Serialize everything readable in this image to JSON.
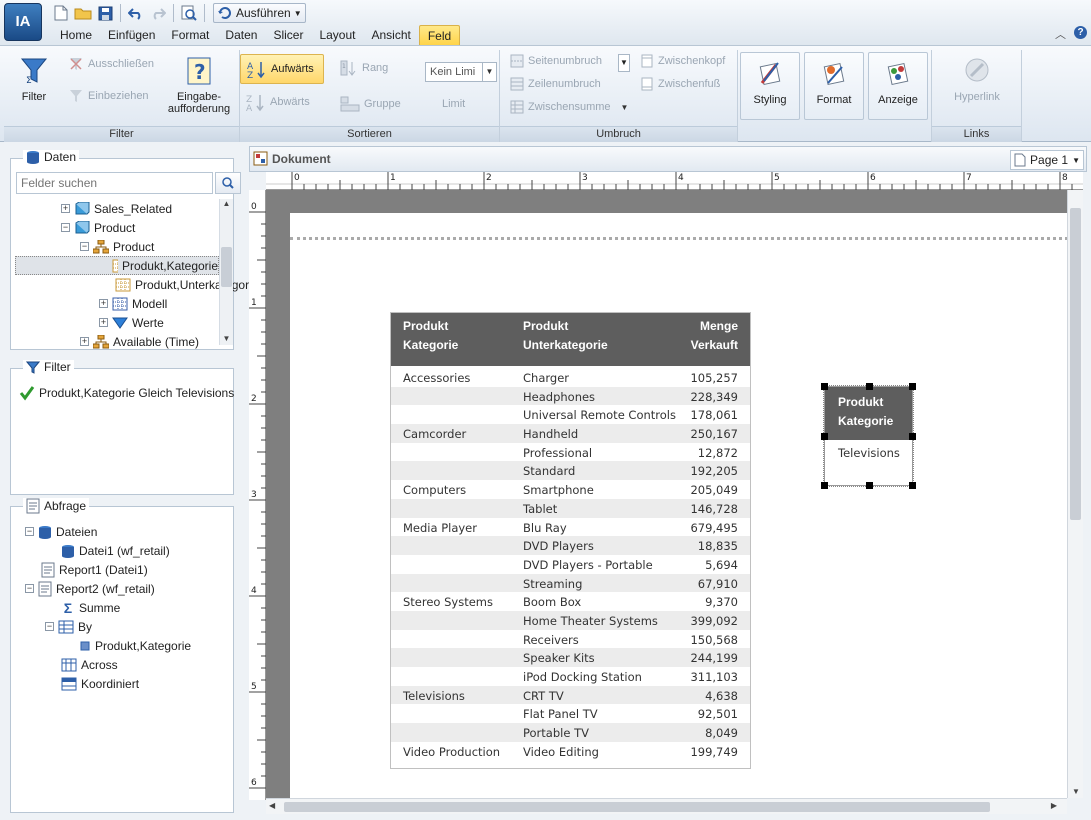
{
  "app": {
    "logo": "IA"
  },
  "quick_access": {
    "run_label": "Ausführen"
  },
  "menu": [
    "Home",
    "Einfügen",
    "Format",
    "Daten",
    "Slicer",
    "Layout",
    "Ansicht",
    "Feld"
  ],
  "menu_active": "Feld",
  "ribbon": {
    "filter_group": {
      "label": "Filter",
      "filter": "Filter",
      "exclude": "Ausschließen",
      "include": "Einbeziehen",
      "prompt_line1": "Eingabe-",
      "prompt_line2": "aufforderung"
    },
    "sort_group": {
      "label": "Sortieren",
      "asc": "Aufwärts",
      "desc": "Abwärts",
      "rank": "Rang",
      "group": "Gruppe",
      "limit_value": "Kein Limi",
      "limit": "Limit"
    },
    "break_group": {
      "label": "Umbruch",
      "page_break": "Seitenumbruch",
      "row_break": "Zeilenumbruch",
      "subtotal": "Zwischensumme",
      "subhead": "Zwischenkopf",
      "subfoot": "Zwischenfuß"
    },
    "styling": "Styling",
    "format": "Format",
    "display": "Anzeige",
    "links_group": {
      "label": "Links",
      "hyperlink": "Hyperlink"
    }
  },
  "data_panel": {
    "title": "Daten",
    "search_placeholder": "Felder suchen",
    "tree": [
      {
        "label": "Sales_Related"
      },
      {
        "label": "Product"
      },
      {
        "label": "Product"
      },
      {
        "label": "Produkt,Kategorie"
      },
      {
        "label": "Produkt,Unterkategorie"
      },
      {
        "label": "Modell"
      },
      {
        "label": "Werte"
      },
      {
        "label": "Available (Time)"
      }
    ]
  },
  "filter_panel": {
    "title": "Filter",
    "condition": "Produkt,Kategorie Gleich Televisions"
  },
  "query_panel": {
    "title": "Abfrage",
    "items": [
      {
        "label": "Dateien"
      },
      {
        "label": "Datei1 (wf_retail)"
      },
      {
        "label": "Report1 (Datei1)"
      },
      {
        "label": "Report2 (wf_retail)"
      },
      {
        "label": "Summe"
      },
      {
        "label": "By"
      },
      {
        "label": "Produkt,Kategorie"
      },
      {
        "label": "Across"
      },
      {
        "label": "Koordiniert"
      }
    ]
  },
  "document": {
    "title": "Dokument",
    "page": "Page 1",
    "ruler_h": [
      "0",
      "1",
      "2",
      "3",
      "4",
      "5",
      "6",
      "7",
      "8"
    ],
    "ruler_v": [
      "0",
      "1",
      "2",
      "3",
      "4",
      "5",
      "6"
    ]
  },
  "report": {
    "headers": {
      "col1_l1": "Produkt",
      "col1_l2": "Kategorie",
      "col2_l1": "Produkt",
      "col2_l2": "Unterkategorie",
      "col3_l1": "Menge",
      "col3_l2": "Verkauft"
    },
    "rows": [
      {
        "cat": "Accessories",
        "sub": "Charger",
        "qty": "105,257"
      },
      {
        "cat": "",
        "sub": "Headphones",
        "qty": "228,349"
      },
      {
        "cat": "",
        "sub": "Universal Remote Controls",
        "qty": "178,061"
      },
      {
        "cat": "Camcorder",
        "sub": "Handheld",
        "qty": "250,167"
      },
      {
        "cat": "",
        "sub": "Professional",
        "qty": "12,872"
      },
      {
        "cat": "",
        "sub": "Standard",
        "qty": "192,205"
      },
      {
        "cat": "Computers",
        "sub": "Smartphone",
        "qty": "205,049"
      },
      {
        "cat": "",
        "sub": "Tablet",
        "qty": "146,728"
      },
      {
        "cat": "Media Player",
        "sub": "Blu Ray",
        "qty": "679,495"
      },
      {
        "cat": "",
        "sub": "DVD Players",
        "qty": "18,835"
      },
      {
        "cat": "",
        "sub": "DVD Players - Portable",
        "qty": "5,694"
      },
      {
        "cat": "",
        "sub": "Streaming",
        "qty": "67,910"
      },
      {
        "cat": "Stereo Systems",
        "sub": "Boom Box",
        "qty": "9,370"
      },
      {
        "cat": "",
        "sub": "Home Theater Systems",
        "qty": "399,092"
      },
      {
        "cat": "",
        "sub": "Receivers",
        "qty": "150,568"
      },
      {
        "cat": "",
        "sub": "Speaker Kits",
        "qty": "244,199"
      },
      {
        "cat": "",
        "sub": "iPod Docking Station",
        "qty": "311,103"
      },
      {
        "cat": "Televisions",
        "sub": "CRT TV",
        "qty": "4,638"
      },
      {
        "cat": "",
        "sub": "Flat Panel TV",
        "qty": "92,501"
      },
      {
        "cat": "",
        "sub": "Portable TV",
        "qty": "8,049"
      },
      {
        "cat": "Video Production",
        "sub": "Video Editing",
        "qty": "199,749"
      }
    ]
  },
  "mini_report": {
    "header_l1": "Produkt",
    "header_l2": "Kategorie",
    "value": "Televisions"
  },
  "colors": {
    "header_bg": "#5e5e5e",
    "alt_row": "#ececec",
    "active_tab": "#ffd44a",
    "accent": "#1a4a86"
  }
}
